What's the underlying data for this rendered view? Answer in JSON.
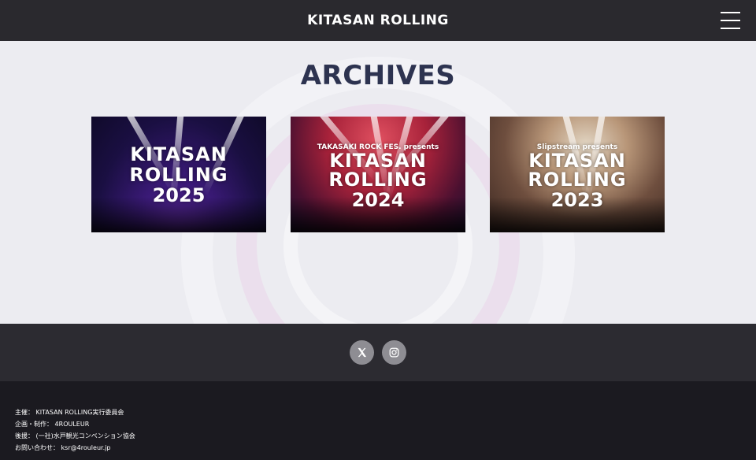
{
  "header": {
    "logo_text": "KITASAN ROLLING",
    "menu_icon": "hamburger-menu-icon"
  },
  "main": {
    "title": "ARCHIVES",
    "archives": [
      {
        "pre": "",
        "line1": "KITASAN",
        "line2": "ROLLING",
        "year": "2025"
      },
      {
        "pre": "TAKASAKI ROCK FES. presents",
        "line1": "KITASAN",
        "line2": "ROLLING",
        "year": "2024"
      },
      {
        "pre": "Slipstream presents",
        "line1": "KITASAN",
        "line2": "ROLLING",
        "year": "2023"
      }
    ]
  },
  "social": [
    {
      "icon": "x-twitter-icon"
    },
    {
      "icon": "instagram-icon"
    }
  ],
  "footer": {
    "credits": [
      {
        "label": "主催：",
        "value": "KITASAN ROLLING実行委員会"
      },
      {
        "label": "企画・制作：",
        "value": "4ROULEUR"
      },
      {
        "label": "後援：",
        "value": "(一社)水戸観光コンベンション協会"
      },
      {
        "label": "お問い合わせ：",
        "value": "ksr@4rouleur.jp"
      }
    ]
  },
  "colors": {
    "header_bg": "#2a292e",
    "main_bg": "#ececf1",
    "title_color": "#2d3350",
    "social_bg": "#2c2b31",
    "footer_bg": "#1b1a20"
  }
}
